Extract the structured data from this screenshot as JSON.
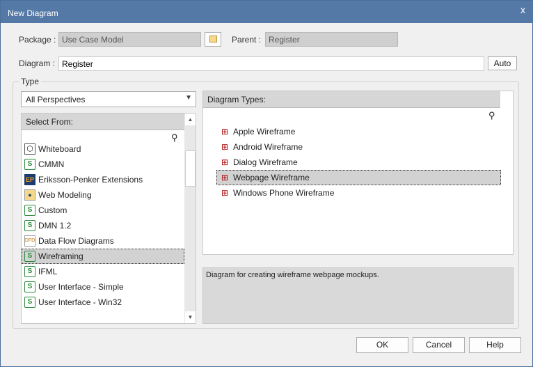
{
  "window": {
    "title": "New Diagram",
    "close": "x"
  },
  "form": {
    "package_label": "Package :",
    "package_value": "Use Case Model",
    "parent_label": "Parent :",
    "parent_value": "Register",
    "diagram_label": "Diagram :",
    "diagram_value": "Register",
    "auto_label": "Auto"
  },
  "type_group": {
    "label": "Type",
    "perspective": "All Perspectives"
  },
  "select_from": {
    "header": "Select From:",
    "items": [
      {
        "label": "Whiteboard",
        "icon": "cube-icon"
      },
      {
        "label": "CMMN",
        "icon": "technology-icon"
      },
      {
        "label": "Eriksson-Penker Extensions",
        "icon": "ep-icon"
      },
      {
        "label": "Web Modeling",
        "icon": "web-icon"
      },
      {
        "label": "Custom",
        "icon": "technology-icon"
      },
      {
        "label": "DMN 1.2",
        "icon": "technology-icon"
      },
      {
        "label": "Data Flow Diagrams",
        "icon": "dfd-icon"
      },
      {
        "label": "Wireframing",
        "icon": "technology-icon",
        "selected": true
      },
      {
        "label": "IFML",
        "icon": "technology-icon"
      },
      {
        "label": "User Interface - Simple",
        "icon": "technology-icon"
      },
      {
        "label": "User Interface - Win32",
        "icon": "technology-icon"
      }
    ]
  },
  "diagram_types": {
    "header": "Diagram Types:",
    "items": [
      {
        "label": "Apple Wireframe"
      },
      {
        "label": "Android Wireframe"
      },
      {
        "label": "Dialog Wireframe"
      },
      {
        "label": "Webpage Wireframe",
        "selected": true
      },
      {
        "label": "Windows Phone Wireframe"
      }
    ]
  },
  "description": "Diagram for creating wireframe webpage mockups.",
  "buttons": {
    "ok": "OK",
    "cancel": "Cancel",
    "help": "Help"
  },
  "colors": {
    "titlebar": "#5579a6",
    "selection": "#d2d2d2"
  }
}
